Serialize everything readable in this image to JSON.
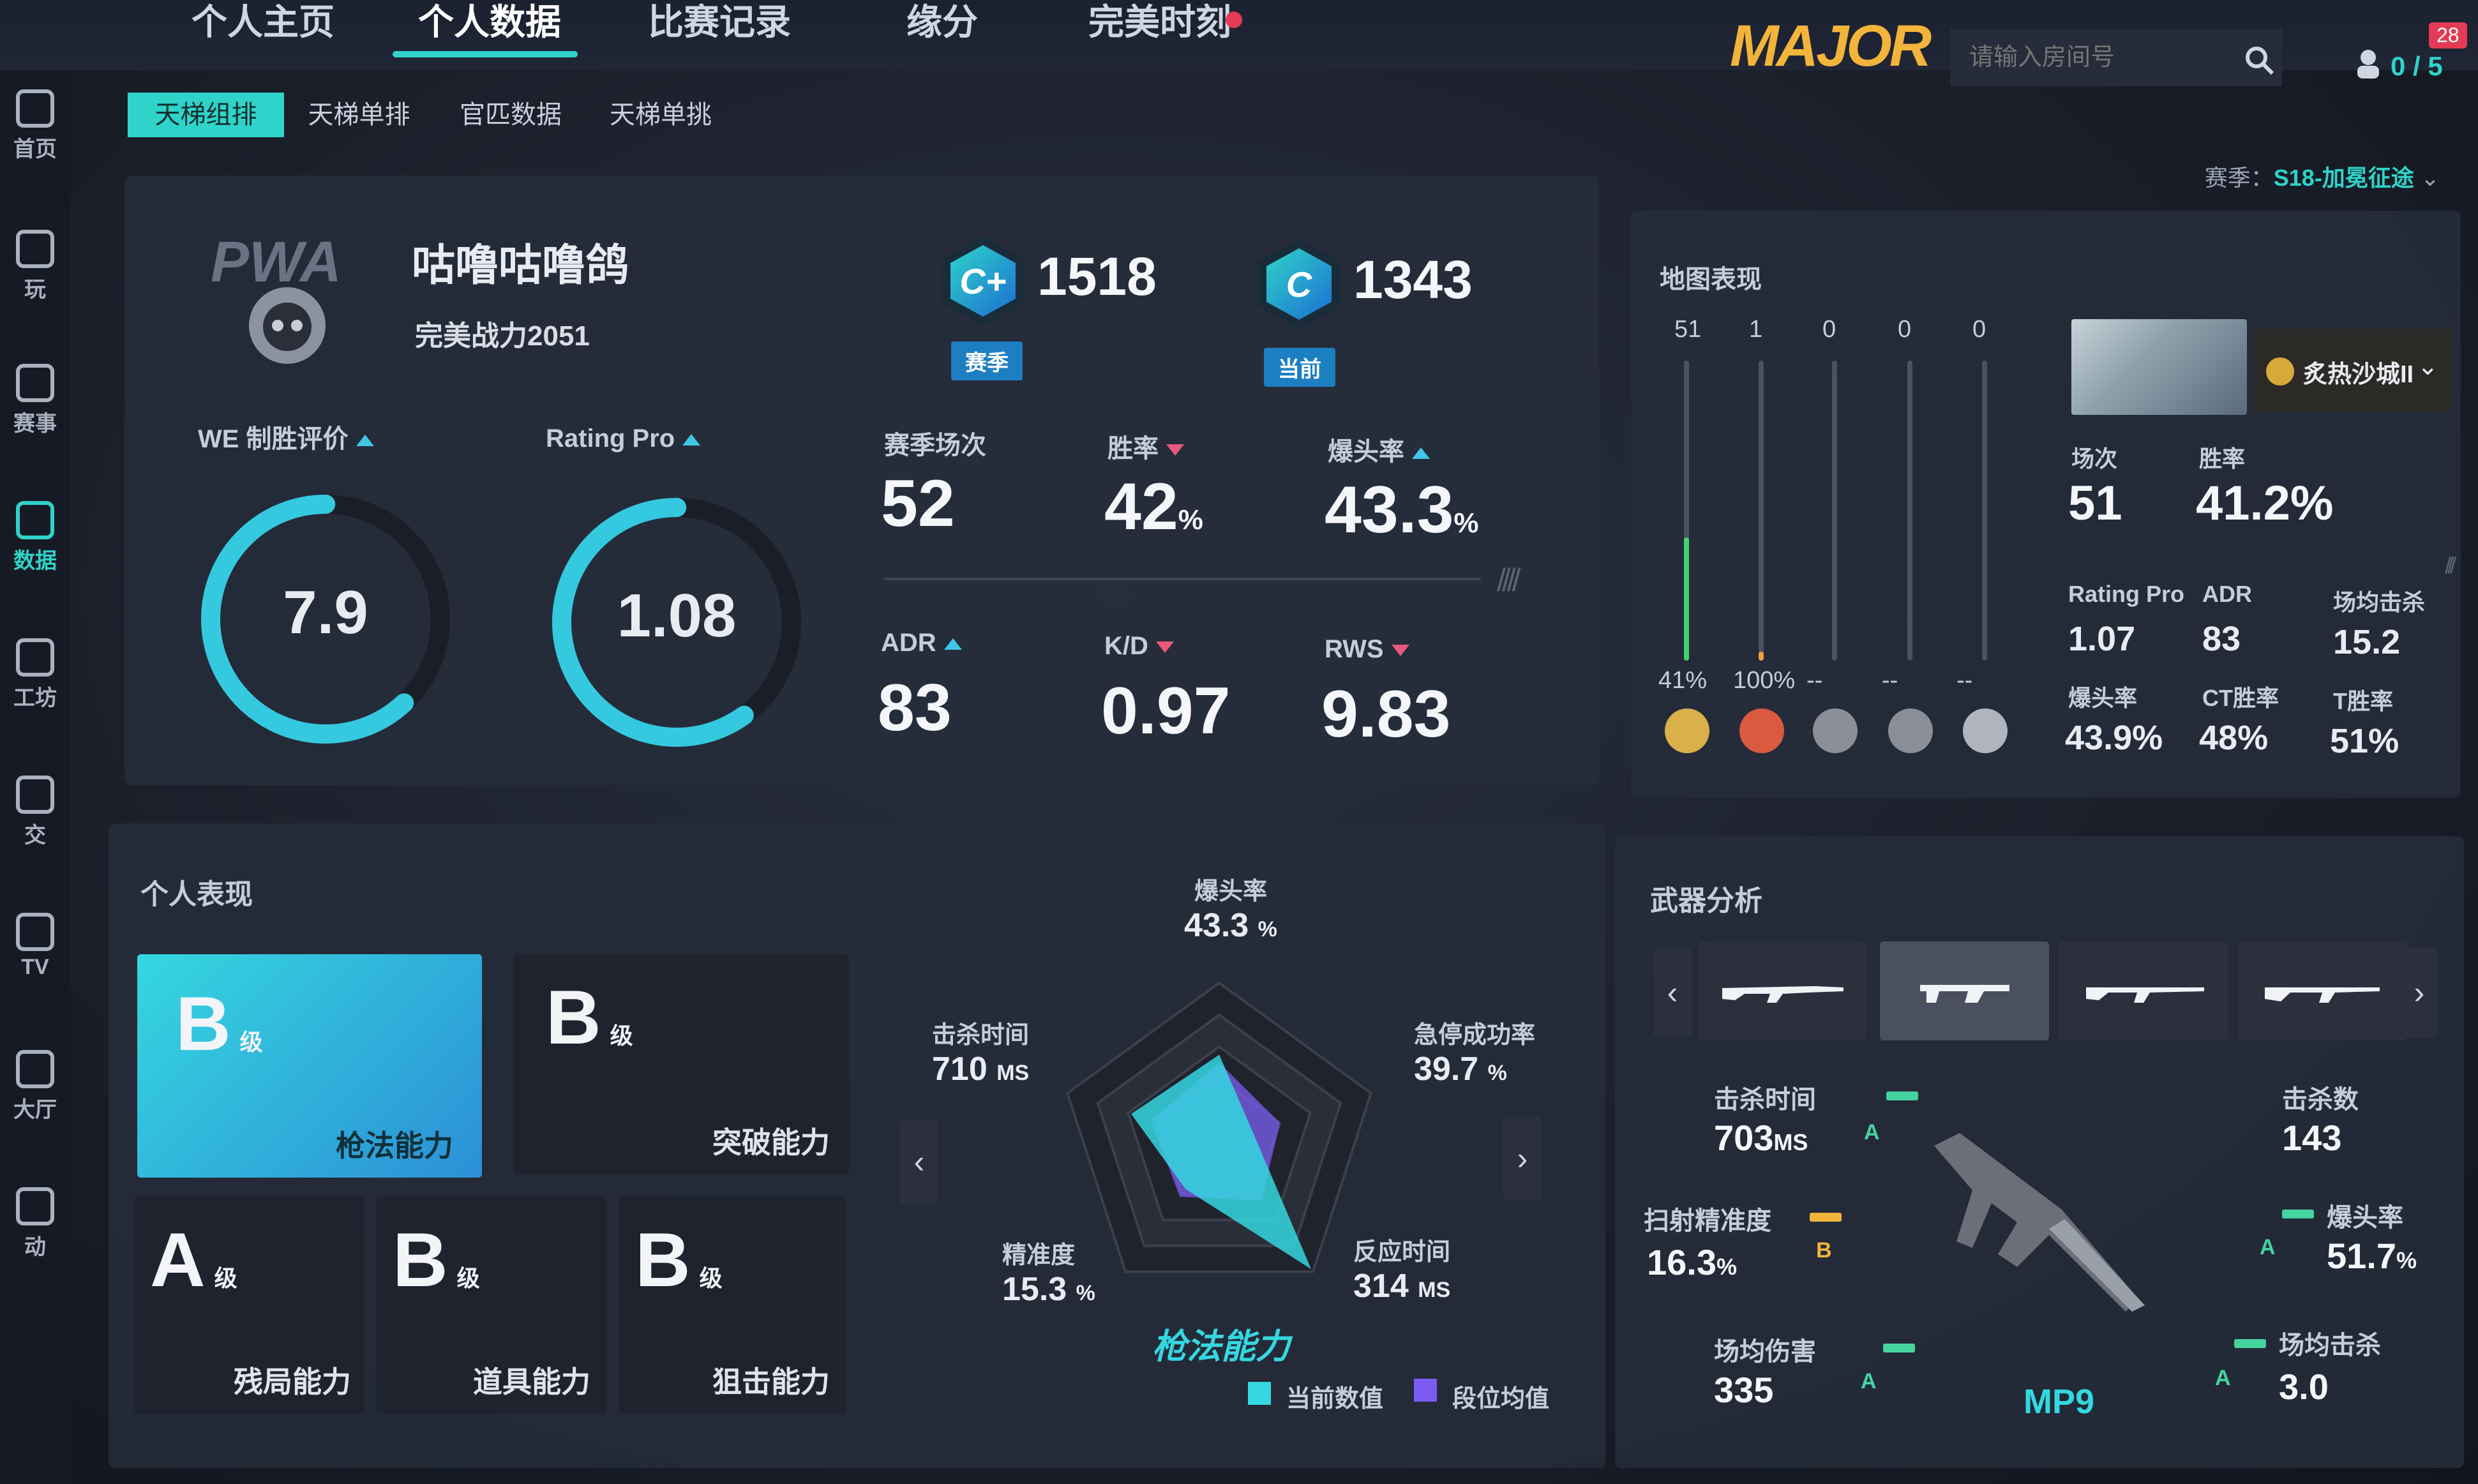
{
  "topnav": {
    "tabs": [
      "个人主页",
      "个人数据",
      "比赛记录",
      "缘分",
      "完美时刻"
    ],
    "logo": "MAJOR",
    "room_placeholder": "请输入房间号",
    "team_count": "0 / 5",
    "notif_count": "28"
  },
  "sidebar": {
    "items": [
      "首页",
      "玩",
      "赛事",
      "数据",
      "工坊",
      "交",
      "TV",
      "大厅",
      "动"
    ]
  },
  "subtabs": [
    "天梯组排",
    "天梯单排",
    "官匹数据",
    "天梯单挑"
  ],
  "season": {
    "label": "赛季：",
    "value": "S18-加冕征途"
  },
  "profile": {
    "avatar_text": "PWA",
    "name": "咕噜咕噜鸽",
    "power": "完美战力2051",
    "we_label": "WE 制胜评价",
    "we_value": "7.9",
    "we_fraction": 0.62,
    "rating_label": "Rating Pro",
    "rating_value": "1.08",
    "rating_fraction": 0.6
  },
  "ranks": [
    {
      "badge": "C+",
      "score": "1518",
      "tag": "赛季"
    },
    {
      "badge": "C",
      "score": "1343",
      "tag": "当前"
    }
  ],
  "stats": [
    {
      "label": "赛季场次",
      "value": "52",
      "unit": "",
      "trend": ""
    },
    {
      "label": "胜率",
      "value": "42",
      "unit": "%",
      "trend": "down"
    },
    {
      "label": "爆头率",
      "value": "43.3",
      "unit": "%",
      "trend": "up"
    },
    {
      "label": "ADR",
      "value": "83",
      "unit": "",
      "trend": "up"
    },
    {
      "label": "K/D",
      "value": "0.97",
      "unit": "",
      "trend": "down"
    },
    {
      "label": "RWS",
      "value": "9.83",
      "unit": "",
      "trend": "down"
    }
  ],
  "performance": {
    "title": "个人表现",
    "cards": [
      {
        "grade": "B",
        "level": "级",
        "name": "枪法能力"
      },
      {
        "grade": "B",
        "level": "级",
        "name": "突破能力"
      },
      {
        "grade": "A",
        "level": "级",
        "name": "残局能力"
      },
      {
        "grade": "B",
        "level": "级",
        "name": "道具能力"
      },
      {
        "grade": "B",
        "level": "级",
        "name": "狙击能力"
      }
    ],
    "radar_title": "枪法能力",
    "radar_axes": [
      {
        "label": "爆头率",
        "value": "43.3",
        "unit": "%"
      },
      {
        "label": "急停成功率",
        "value": "39.7",
        "unit": "%"
      },
      {
        "label": "反应时间",
        "value": "314",
        "unit": "MS"
      },
      {
        "label": "精准度",
        "value": "15.3",
        "unit": "%"
      },
      {
        "label": "击杀时间",
        "value": "710",
        "unit": "MS"
      }
    ],
    "radar_current": [
      0.55,
      0.22,
      0.98,
      0.36,
      0.58
    ],
    "radar_average": [
      0.5,
      0.4,
      0.45,
      0.42,
      0.45
    ],
    "legend_current": "当前数值",
    "legend_average": "段位均值",
    "color_current": "#35d7e0",
    "color_average": "#7a5cf0"
  },
  "map": {
    "title": "地图表现",
    "bars": [
      {
        "count": "51",
        "rate": "41%",
        "fill": 0.41,
        "color": "#45d36b"
      },
      {
        "count": "1",
        "rate": "100%",
        "fill": 0.02,
        "color": "#f0a13a"
      },
      {
        "count": "0",
        "rate": "--",
        "fill": 0,
        "color": "#45d36b"
      },
      {
        "count": "0",
        "rate": "--",
        "fill": 0,
        "color": "#45d36b"
      },
      {
        "count": "0",
        "rate": "--",
        "fill": 0,
        "color": "#45d36b"
      }
    ],
    "selected": "炙热沙城II",
    "games_label": "场次",
    "games": "51",
    "winrate_label": "胜率",
    "winrate": "41.2%",
    "details": [
      {
        "label": "Rating Pro",
        "value": "1.07"
      },
      {
        "label": "ADR",
        "value": "83"
      },
      {
        "label": "场均击杀",
        "value": "15.2"
      },
      {
        "label": "爆头率",
        "value": "43.9%"
      },
      {
        "label": "CT胜率",
        "value": "48%"
      },
      {
        "label": "T胜率",
        "value": "51%"
      }
    ]
  },
  "weapon": {
    "title": "武器分析",
    "name": "MP9",
    "stats": [
      {
        "label": "击杀时间",
        "value": "703",
        "unit": "MS",
        "grade": "A"
      },
      {
        "label": "击杀数",
        "value": "143",
        "unit": "",
        "grade": ""
      },
      {
        "label": "扫射精准度",
        "value": "16.3",
        "unit": "%",
        "grade": "B"
      },
      {
        "label": "爆头率",
        "value": "51.7",
        "unit": "%",
        "grade": "A"
      },
      {
        "label": "场均伤害",
        "value": "335",
        "unit": "",
        "grade": "A"
      },
      {
        "label": "场均击杀",
        "value": "3.0",
        "unit": "",
        "grade": "A"
      }
    ]
  }
}
